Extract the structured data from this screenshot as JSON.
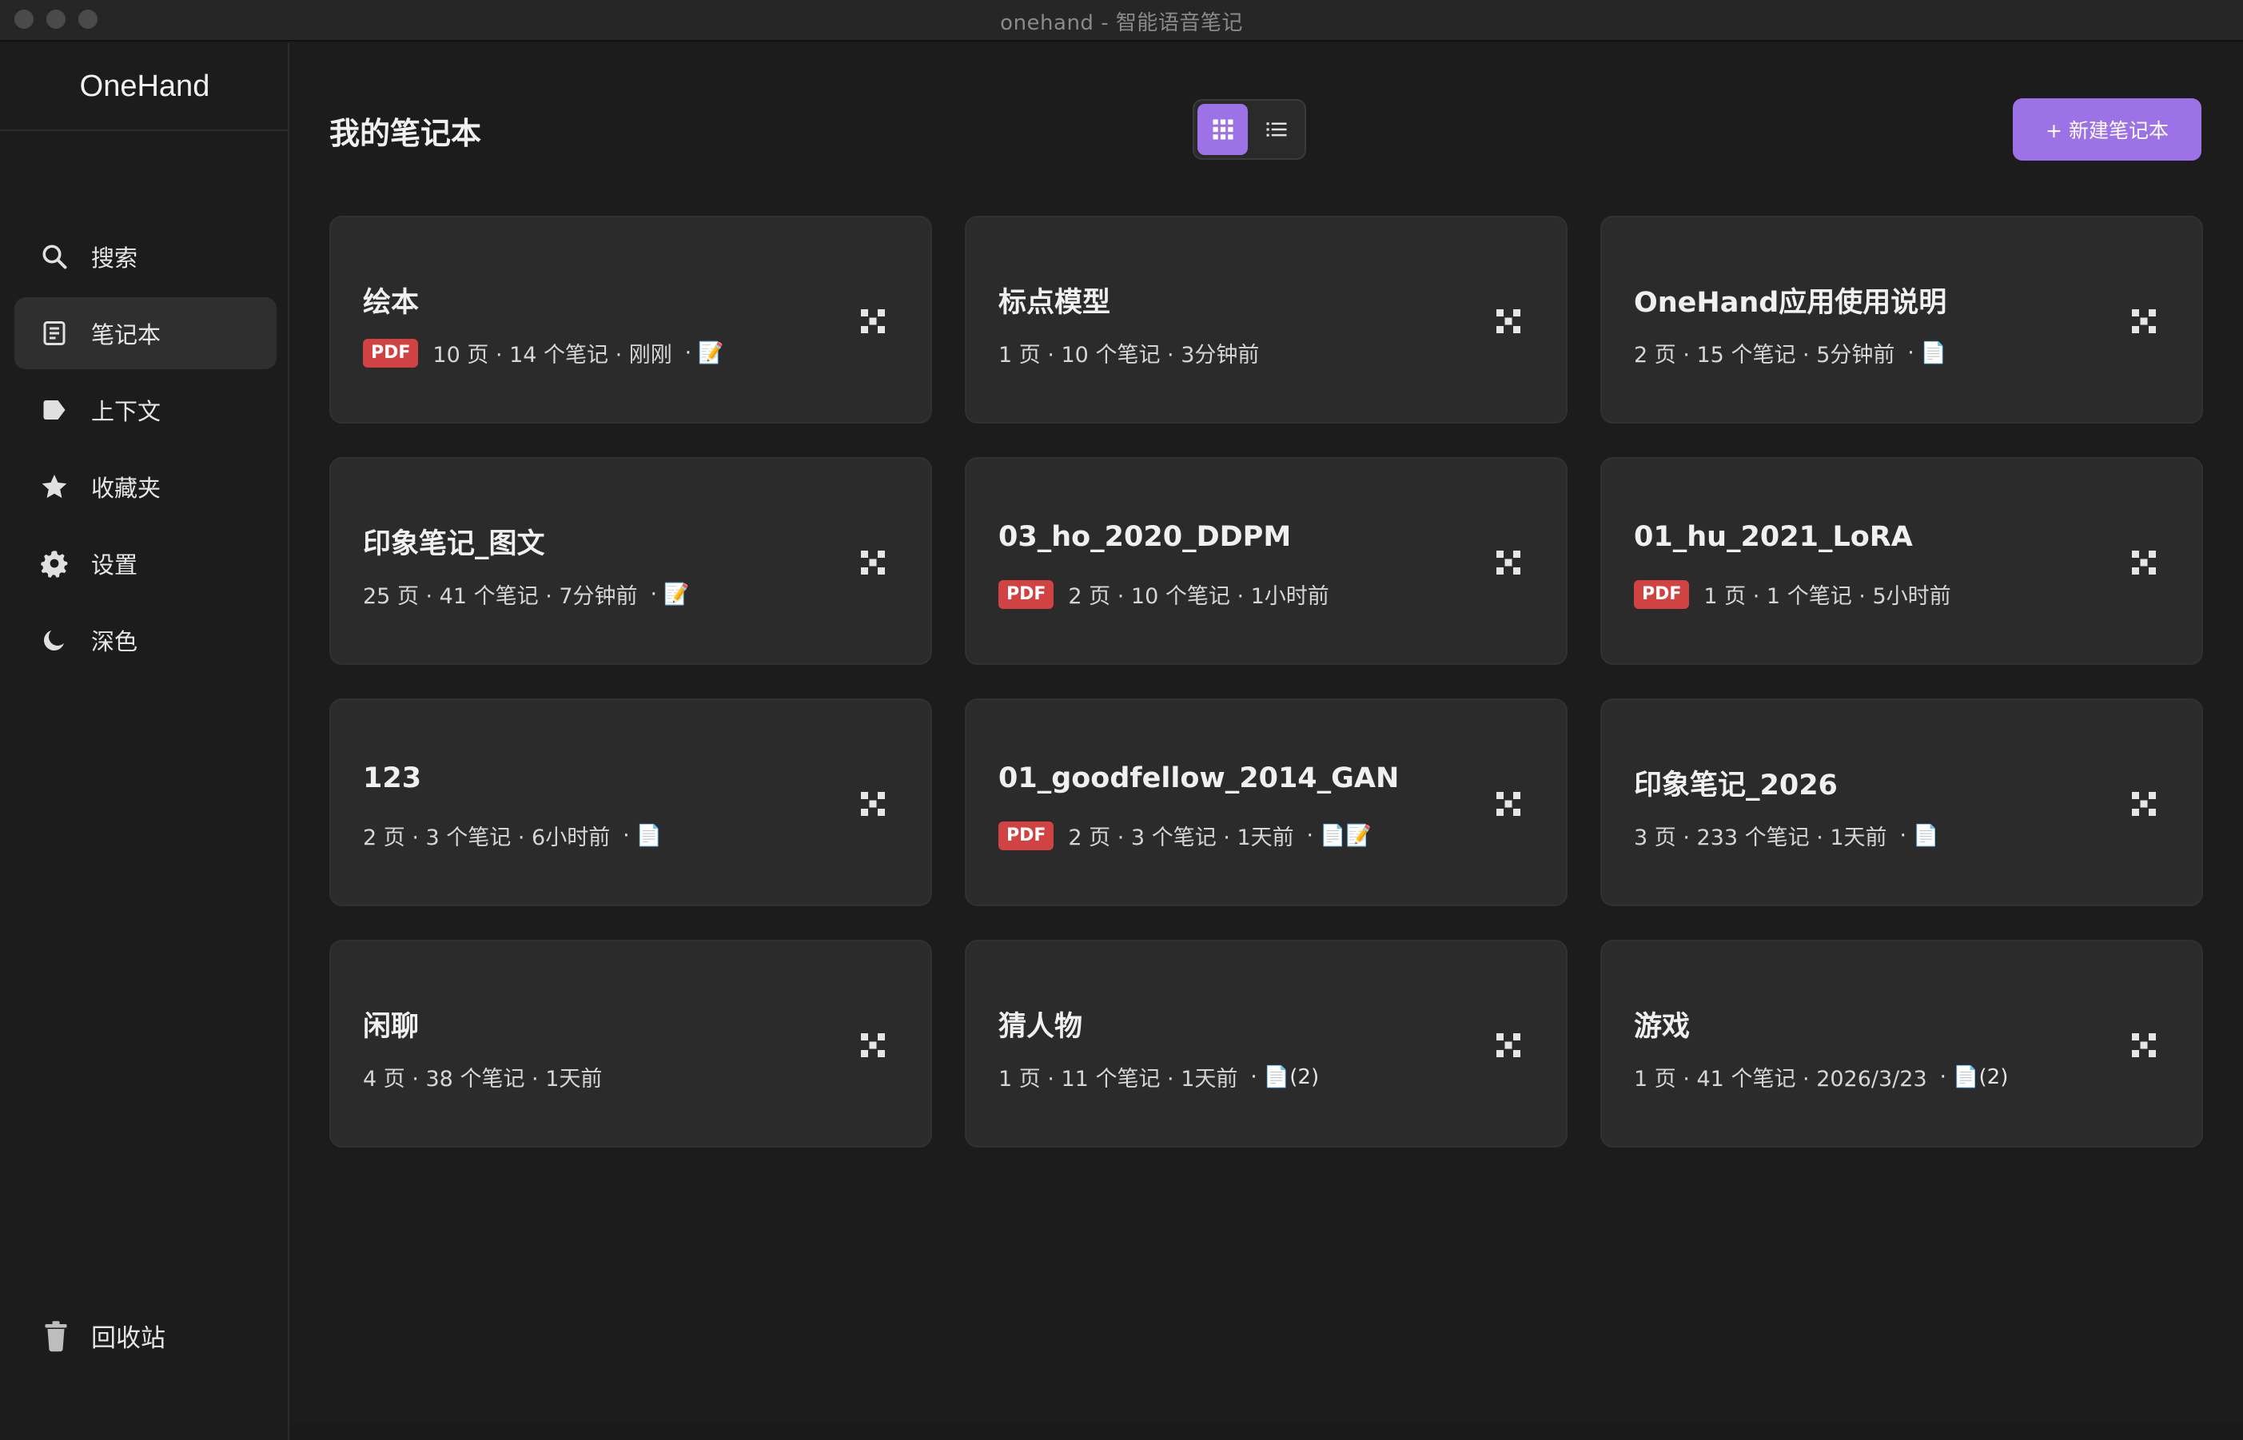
{
  "window": {
    "title": "onehand - 智能语音笔记"
  },
  "sidebar": {
    "brand": "OneHand",
    "items": [
      {
        "label": "搜索",
        "icon": "search-icon",
        "active": false
      },
      {
        "label": "笔记本",
        "icon": "notebook-icon",
        "active": true
      },
      {
        "label": "上下文",
        "icon": "tag-icon",
        "active": false
      },
      {
        "label": "收藏夹",
        "icon": "star-icon",
        "active": false
      },
      {
        "label": "设置",
        "icon": "gear-icon",
        "active": false
      },
      {
        "label": "深色",
        "icon": "moon-icon",
        "active": false
      }
    ],
    "trash_label": "回收站"
  },
  "main": {
    "title": "我的笔记本",
    "view_mode": "grid",
    "new_button_label": "+ 新建笔记本",
    "accent_color": "#9d72e6",
    "notebooks": [
      {
        "title": "绘本",
        "pdf": true,
        "meta": "10 页 · 14 个笔记 · 刚刚",
        "icons": "· 📝"
      },
      {
        "title": "标点模型",
        "pdf": false,
        "meta": "1 页 · 10 个笔记 · 3分钟前",
        "icons": ""
      },
      {
        "title": "OneHand应用使用说明",
        "pdf": false,
        "meta": "2 页 · 15 个笔记 · 5分钟前",
        "icons": "· 📄"
      },
      {
        "title": "印象笔记_图文",
        "pdf": false,
        "meta": "25 页 · 41 个笔记 · 7分钟前",
        "icons": "· 📝"
      },
      {
        "title": "03_ho_2020_DDPM",
        "pdf": true,
        "meta": "2 页 · 10 个笔记 · 1小时前",
        "icons": ""
      },
      {
        "title": "01_hu_2021_LoRA",
        "pdf": true,
        "meta": "1 页 · 1 个笔记 · 5小时前",
        "icons": ""
      },
      {
        "title": "123",
        "pdf": false,
        "meta": "2 页 · 3 个笔记 · 6小时前",
        "icons": "· 📄"
      },
      {
        "title": "01_goodfellow_2014_GAN",
        "pdf": true,
        "meta": "2 页 · 3 个笔记 · 1天前",
        "icons": "· 📄📝"
      },
      {
        "title": "印象笔记_2026",
        "pdf": false,
        "meta": "3 页 · 233 个笔记 · 1天前",
        "icons": "· 📄"
      },
      {
        "title": "闲聊",
        "pdf": false,
        "meta": "4 页 · 38 个笔记 · 1天前",
        "icons": ""
      },
      {
        "title": "猜人物",
        "pdf": false,
        "meta": "1 页 · 11 个笔记 · 1天前",
        "icons": "· 📄(2)"
      },
      {
        "title": "游戏",
        "pdf": false,
        "meta": "1 页 · 41 个笔记 · 2026/3/23",
        "icons": "· 📄(2)"
      }
    ],
    "pdf_badge_label": "PDF"
  }
}
